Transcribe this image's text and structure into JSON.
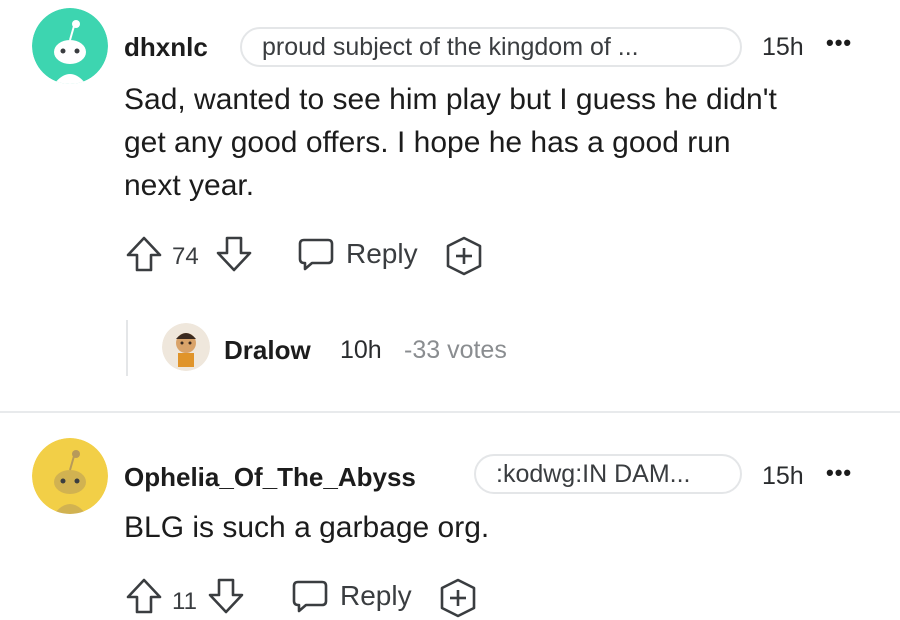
{
  "comments": [
    {
      "username": "dhxnlc",
      "flair": "proud subject of the kingdom of ...",
      "time": "15h",
      "more": "•••",
      "body_lines": [
        "Sad, wanted to see him play but I guess he didn't",
        "get any good offers. I hope he has a good run",
        "next year."
      ],
      "votes": "74",
      "reply_label": "Reply",
      "avatar_color": "#3dd5b0"
    },
    {
      "username": "Ophelia_Of_The_Abyss",
      "flair": ":kodwg:IN DAM...",
      "time": "15h",
      "more": "•••",
      "body_lines": [
        "BLG is such a garbage org."
      ],
      "votes": "11",
      "reply_label": "Reply",
      "avatar_color": "#f2cf47"
    }
  ],
  "collapsed_reply": {
    "username": "Dralow",
    "time": "10h",
    "votes_text": "-33 votes"
  },
  "colors": {
    "text": "#1c1c1c",
    "muted": "#8a8d90",
    "divider": "#e8eaec"
  },
  "icons": [
    "upvote-icon",
    "downvote-icon",
    "reply-bubble-icon",
    "award-plus-icon",
    "overflow-dots-icon"
  ]
}
